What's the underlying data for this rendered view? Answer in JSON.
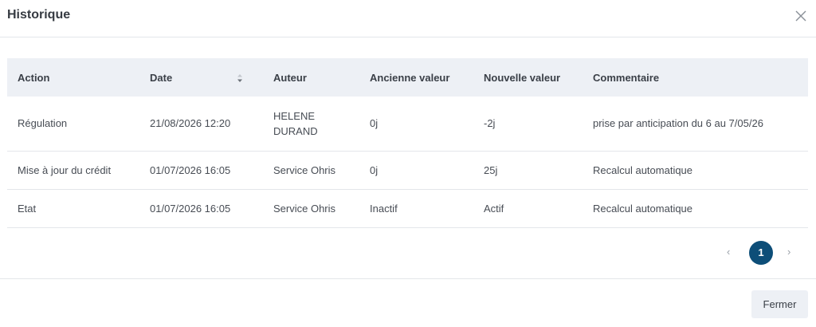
{
  "dialog": {
    "title": "Historique"
  },
  "table": {
    "headers": [
      "Action",
      "Date",
      "Auteur",
      "Ancienne valeur",
      "Nouvelle valeur",
      "Commentaire"
    ],
    "rows": [
      [
        "Régulation",
        "21/08/2026 12:20",
        "HELENE DURAND",
        "0j",
        "-2j",
        "prise par anticipation du 6 au 7/05/26"
      ],
      [
        "Mise à jour du crédit",
        "01/07/2026 16:05",
        "Service Ohris",
        "0j",
        "25j",
        "Recalcul automatique"
      ],
      [
        "Etat",
        "01/07/2026 16:05",
        "Service Ohris",
        "Inactif",
        "Actif",
        "Recalcul automatique"
      ]
    ]
  },
  "pagination": {
    "prev": "‹",
    "current": "1",
    "next": "›"
  },
  "footer": {
    "close_label": "Fermer"
  },
  "colors": {
    "accent": "#0d4e78",
    "header_bg": "#edf0f5"
  }
}
